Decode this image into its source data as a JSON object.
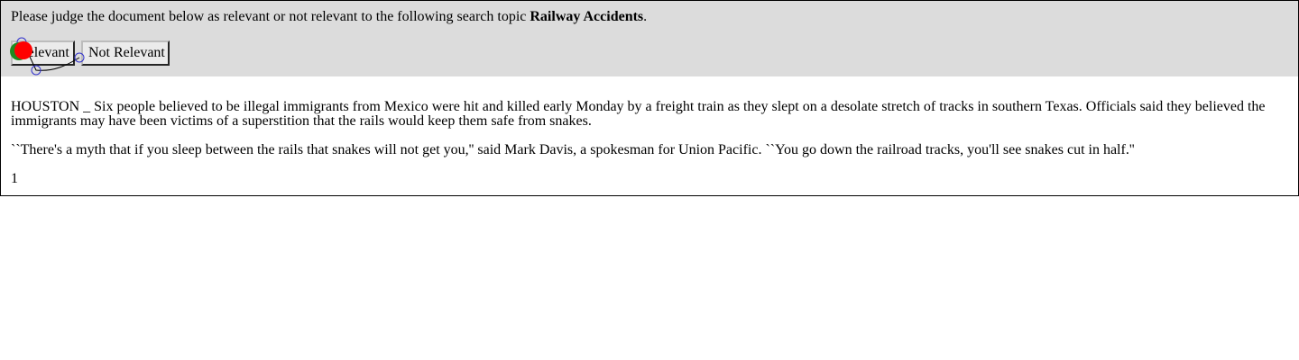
{
  "judge_panel": {
    "prompt_text": "Please judge the document below as relevant or not relevant to the following search topic ",
    "topic": "Railway Accidents",
    "prompt_end": ".",
    "relevant_label": "Relevant",
    "not_relevant_label": "Not Relevant"
  },
  "document": {
    "paragraphs": [
      "HOUSTON _ Six people believed to be illegal immigrants from Mexico were hit and killed early Monday by a freight train as they slept on a desolate stretch of tracks in southern Texas. Officials said they believed the immigrants may have been victims of a superstition that the rails would keep them safe from snakes.",
      "``There's a myth that if you sleep between the rails that snakes will not get you,'' said Mark Davis, a spokesman for Union Pacific. ``You go down the railroad tracks, you'll see snakes cut in half.''"
    ],
    "page_number": "1"
  },
  "colors": {
    "panel_bg": "#dcdcdc",
    "marker_green": "#1f8a1f",
    "marker_red": "#ff0000",
    "trace_blue": "#3333cc"
  }
}
